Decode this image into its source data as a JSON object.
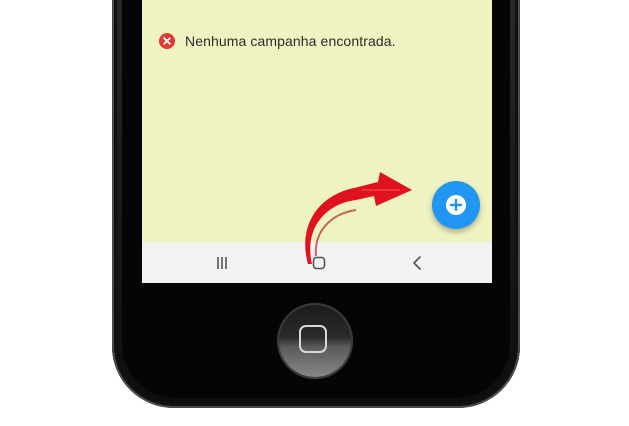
{
  "empty_state": {
    "icon": "error-circle-icon",
    "icon_color": "#e53935",
    "message": "Nenhuma campanha encontrada."
  },
  "fab": {
    "icon": "plus-icon",
    "color": "#2196f3"
  },
  "navbar": {
    "recents_icon": "recents-icon",
    "home_icon": "home-icon",
    "back_icon": "back-icon"
  },
  "annotation": {
    "icon": "pointer-arrow",
    "color": "#e0121d"
  },
  "device": {
    "home_key_icon": "home-button-icon"
  },
  "colors": {
    "screen_background": "#eef3c1",
    "navbar_background": "#f2f2f2"
  }
}
